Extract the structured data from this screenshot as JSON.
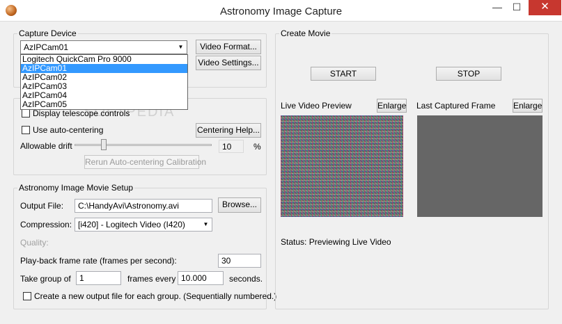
{
  "window": {
    "title": "Astronomy Image Capture",
    "minimize_glyph": "—",
    "maximize_glyph": "☐",
    "close_glyph": "✕"
  },
  "capture_device": {
    "legend": "Capture Device",
    "selected": "AzIPCam01",
    "options": [
      "Logitech QuickCam Pro 9000",
      "AzIPCam01",
      "AzIPCam02",
      "AzIPCam03",
      "AzIPCam04",
      "AzIPCam05"
    ],
    "highlighted_index": 1,
    "video_format_label": "Video Format...",
    "video_settings_label": "Video Settings..."
  },
  "telescope": {
    "display_controls_label": "Display telescope controls",
    "auto_centering_label": "Use auto-centering",
    "centering_help_label": "Centering Help...",
    "allowable_drift_label": "Allowable drift",
    "drift_value": "10",
    "drift_unit": "%",
    "drift_slider_fraction": 0.2,
    "run_calibration_label": "Rerun Auto-centering Calibration"
  },
  "movie_setup": {
    "legend": "Astronomy Image Movie Setup",
    "output_file_label": "Output File:",
    "output_file_value": "C:\\HandyAvi\\Astronomy.avi",
    "browse_label": "Browse...",
    "compression_label": "Compression:",
    "compression_value": "[i420] - Logitech Video (I420)",
    "quality_label": "Quality:",
    "frame_rate_label": "Play-back frame rate (frames per second):",
    "frame_rate_value": "30",
    "take_group_label": "Take group of",
    "group_value": "1",
    "frames_every_label": "frames every",
    "interval_value": "10.000",
    "seconds_label": "seconds.",
    "new_file_label": "Create a new output file for each group.  (Sequentially numbered.)"
  },
  "create_movie": {
    "legend": "Create Movie",
    "start_label": "START",
    "stop_label": "STOP",
    "live_preview_label": "Live Video Preview",
    "enlarge_label": "Enlarge",
    "last_frame_label": "Last Captured Frame",
    "status_text": "Status: Previewing Live Video"
  },
  "watermark_text": "SOFTPEDIA"
}
